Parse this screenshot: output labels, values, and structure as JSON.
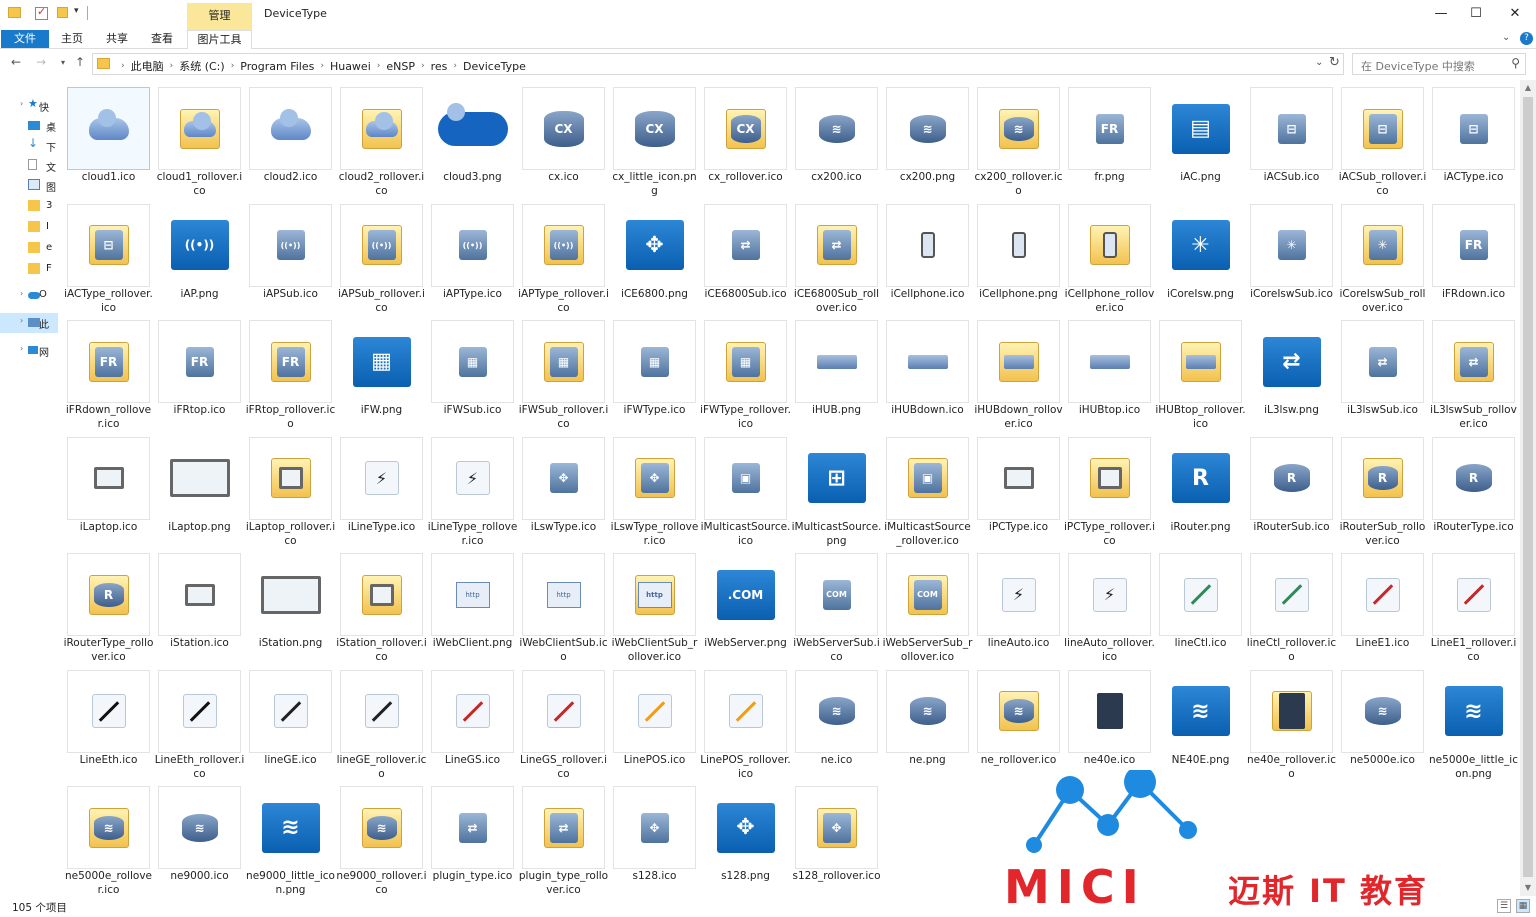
{
  "window": {
    "title": "DeviceType",
    "manage_tab": "管理",
    "minimize": "—",
    "maximize": "☐",
    "close": "✕"
  },
  "ribbon": {
    "tabs": [
      {
        "label": "文件"
      },
      {
        "label": "主页"
      },
      {
        "label": "共享"
      },
      {
        "label": "查看"
      },
      {
        "label": "图片工具"
      }
    ]
  },
  "address": {
    "crumbs": [
      "此电脑",
      "系统 (C:)",
      "Program Files",
      "Huawei",
      "eNSP",
      "res",
      "DeviceType"
    ],
    "search_placeholder": "在 DeviceType 中搜索"
  },
  "sidebar": {
    "items": [
      {
        "label": "快",
        "icon": "star-icon"
      },
      {
        "label": "桌",
        "icon": "desktop-icon"
      },
      {
        "label": "下",
        "icon": "download-icon"
      },
      {
        "label": "文",
        "icon": "document-icon"
      },
      {
        "label": "图",
        "icon": "picture-icon"
      },
      {
        "label": "3",
        "icon": "folder-icon"
      },
      {
        "label": "I",
        "icon": "folder-icon"
      },
      {
        "label": "e",
        "icon": "folder-icon"
      },
      {
        "label": "F",
        "icon": "folder-icon"
      },
      {
        "label": "O",
        "icon": "onedrive-icon"
      },
      {
        "label": "此",
        "icon": "this-pc-icon"
      },
      {
        "label": "网",
        "icon": "network-icon"
      }
    ]
  },
  "files": [
    {
      "name": "cloud1.ico",
      "icon": "cloud-icon",
      "selected": true
    },
    {
      "name": "cloud1_rollover.ico",
      "icon": "cloud-gold-icon"
    },
    {
      "name": "cloud2.ico",
      "icon": "cloud-icon"
    },
    {
      "name": "cloud2_rollover.ico",
      "icon": "cloud-gold-icon"
    },
    {
      "name": "cloud3.png",
      "icon": "cloud-big-icon"
    },
    {
      "name": "cx.ico",
      "icon": "cx-router-icon"
    },
    {
      "name": "cx_little_icon.png",
      "icon": "cx-router-icon"
    },
    {
      "name": "cx_rollover.ico",
      "icon": "cx-router-gold-icon"
    },
    {
      "name": "cx200.ico",
      "icon": "router-icon"
    },
    {
      "name": "cx200.png",
      "icon": "router-icon"
    },
    {
      "name": "cx200_rollover.ico",
      "icon": "router-gold-icon"
    },
    {
      "name": "fr.png",
      "icon": "frsw-icon"
    },
    {
      "name": "iAC.png",
      "icon": "ac-blue-icon"
    },
    {
      "name": "iACSub.ico",
      "icon": "ac-icon"
    },
    {
      "name": "iACSub_rollover.ico",
      "icon": "ac-gold-icon"
    },
    {
      "name": "iACType.ico",
      "icon": "ac-icon"
    },
    {
      "name": "iACType_rollover.ico",
      "icon": "ac-gold-icon"
    },
    {
      "name": "iAP.png",
      "icon": "ap-blue-icon"
    },
    {
      "name": "iAPSub.ico",
      "icon": "ap-icon"
    },
    {
      "name": "iAPSub_rollover.ico",
      "icon": "ap-gold-icon"
    },
    {
      "name": "iAPType.ico",
      "icon": "ap-icon"
    },
    {
      "name": "iAPType_rollover.ico",
      "icon": "ap-gold-icon"
    },
    {
      "name": "iCE6800.png",
      "icon": "ce-cloud-blue-icon"
    },
    {
      "name": "iCE6800Sub.ico",
      "icon": "switch-icon"
    },
    {
      "name": "iCE6800Sub_rollover.ico",
      "icon": "switch-gold-icon"
    },
    {
      "name": "iCellphone.ico",
      "icon": "cellphone-icon"
    },
    {
      "name": "iCellphone.png",
      "icon": "cellphone-icon"
    },
    {
      "name": "iCellphone_rollover.ico",
      "icon": "cellphone-gold-icon"
    },
    {
      "name": "iCoreIsw.png",
      "icon": "core-switch-blue-icon"
    },
    {
      "name": "iCoreIswSub.ico",
      "icon": "core-switch-icon"
    },
    {
      "name": "iCoreIswSub_rollover.ico",
      "icon": "core-switch-gold-icon"
    },
    {
      "name": "iFRdown.ico",
      "icon": "frsw-icon"
    },
    {
      "name": "iFRdown_rollover.ico",
      "icon": "frsw-gold-icon"
    },
    {
      "name": "iFRtop.ico",
      "icon": "frsw-icon"
    },
    {
      "name": "iFRtop_rollover.ico",
      "icon": "frsw-gold-icon"
    },
    {
      "name": "iFW.png",
      "icon": "firewall-blue-icon"
    },
    {
      "name": "iFWSub.ico",
      "icon": "firewall-icon"
    },
    {
      "name": "iFWSub_rollover.ico",
      "icon": "firewall-gold-icon"
    },
    {
      "name": "iFWType.ico",
      "icon": "firewall-icon"
    },
    {
      "name": "iFWType_rollover.ico",
      "icon": "firewall-gold-icon"
    },
    {
      "name": "iHUB.png",
      "icon": "hub-icon"
    },
    {
      "name": "iHUBdown.ico",
      "icon": "hub-icon"
    },
    {
      "name": "iHUBdown_rollover.ico",
      "icon": "hub-gold-icon"
    },
    {
      "name": "iHUBtop.ico",
      "icon": "hub-icon"
    },
    {
      "name": "iHUBtop_rollover.ico",
      "icon": "hub-gold-icon"
    },
    {
      "name": "iL3lsw.png",
      "icon": "l3-switch-blue-icon"
    },
    {
      "name": "iL3lswSub.ico",
      "icon": "l3-switch-icon"
    },
    {
      "name": "iL3lswSub_rollover.ico",
      "icon": "l3-switch-gold-icon"
    },
    {
      "name": "iLaptop.ico",
      "icon": "pc-icon"
    },
    {
      "name": "iLaptop.png",
      "icon": "desktop-pc-icon"
    },
    {
      "name": "iLaptop_rollover.ico",
      "icon": "pc-gold-icon"
    },
    {
      "name": "iLineType.ico",
      "icon": "line-type-icon"
    },
    {
      "name": "iLineType_rollover.ico",
      "icon": "line-type-gold-icon"
    },
    {
      "name": "iLswType.ico",
      "icon": "lsw-icon"
    },
    {
      "name": "iLswType_rollover.ico",
      "icon": "lsw-gold-icon"
    },
    {
      "name": "iMulticastSource.ico",
      "icon": "server-icon"
    },
    {
      "name": "iMulticastSource.png",
      "icon": "multicast-blue-icon"
    },
    {
      "name": "iMulticastSource_rollover.ico",
      "icon": "server-gold-icon"
    },
    {
      "name": "iPCType.ico",
      "icon": "monitor-icon"
    },
    {
      "name": "iPCType_rollover.ico",
      "icon": "monitor-gold-icon"
    },
    {
      "name": "iRouter.png",
      "icon": "router-blue-icon"
    },
    {
      "name": "iRouterSub.ico",
      "icon": "router-r-icon"
    },
    {
      "name": "iRouterSub_rollover.ico",
      "icon": "router-r-gold-icon"
    },
    {
      "name": "iRouterType.ico",
      "icon": "router-r-icon"
    },
    {
      "name": "iRouterType_rollover.ico",
      "icon": "router-r-gold-icon"
    },
    {
      "name": "iStation.ico",
      "icon": "laptop-icon"
    },
    {
      "name": "iStation.png",
      "icon": "laptop-big-icon"
    },
    {
      "name": "iStation_rollover.ico",
      "icon": "laptop-gold-icon"
    },
    {
      "name": "iWebClient.png",
      "icon": "webclient-icon"
    },
    {
      "name": "iWebClientSub.ico",
      "icon": "webclient-icon"
    },
    {
      "name": "iWebClientSub_rollover.ico",
      "icon": "webclient-gold-icon"
    },
    {
      "name": "iWebServer.png",
      "icon": "webserver-blue-icon"
    },
    {
      "name": "iWebServerSub.ico",
      "icon": "webserver-icon"
    },
    {
      "name": "iWebServerSub_rollover.ico",
      "icon": "webserver-gold-icon"
    },
    {
      "name": "lineAuto.ico",
      "icon": "line-auto-icon"
    },
    {
      "name": "lineAuto_rollover.ico",
      "icon": "line-auto-gold-icon"
    },
    {
      "name": "lineCtl.ico",
      "icon": "line-ctl-icon"
    },
    {
      "name": "lineCtl_rollover.ico",
      "icon": "line-ctl-gold-icon"
    },
    {
      "name": "LineE1.ico",
      "icon": "line-e1-icon"
    },
    {
      "name": "LineE1_rollover.ico",
      "icon": "line-e1-gold-icon"
    },
    {
      "name": "LineEth.ico",
      "icon": "line-eth-icon"
    },
    {
      "name": "LineEth_rollover.ico",
      "icon": "line-eth-gold-icon"
    },
    {
      "name": "lineGE.ico",
      "icon": "line-ge-icon"
    },
    {
      "name": "lineGE_rollover.ico",
      "icon": "line-ge-gold-icon"
    },
    {
      "name": "LineGS.ico",
      "icon": "line-gs-icon"
    },
    {
      "name": "LineGS_rollover.ico",
      "icon": "line-gs-gold-icon"
    },
    {
      "name": "LinePOS.ico",
      "icon": "line-pos-icon"
    },
    {
      "name": "LinePOS_rollover.ico",
      "icon": "line-pos-gold-icon"
    },
    {
      "name": "ne.ico",
      "icon": "ne-icon"
    },
    {
      "name": "ne.png",
      "icon": "ne-icon"
    },
    {
      "name": "ne_rollover.ico",
      "icon": "ne-gold-icon"
    },
    {
      "name": "ne40e.ico",
      "icon": "chassis-icon"
    },
    {
      "name": "NE40E.png",
      "icon": "ne-blue-icon"
    },
    {
      "name": "ne40e_rollover.ico",
      "icon": "chassis-gold-icon"
    },
    {
      "name": "ne5000e.ico",
      "icon": "ne-icon"
    },
    {
      "name": "ne5000e_little_icon.png",
      "icon": "ne-blue-icon"
    },
    {
      "name": "ne5000e_rollover.ico",
      "icon": "ne-gold-icon"
    },
    {
      "name": "ne9000.ico",
      "icon": "ne-icon"
    },
    {
      "name": "ne9000_little_icon.png",
      "icon": "ne-blue-icon"
    },
    {
      "name": "ne9000_rollover.ico",
      "icon": "ne-gold-icon"
    },
    {
      "name": "plugin_type.ico",
      "icon": "plugin-icon"
    },
    {
      "name": "plugin_type_rollover.ico",
      "icon": "plugin-gold-icon"
    },
    {
      "name": "s128.ico",
      "icon": "s128-icon"
    },
    {
      "name": "s128.png",
      "icon": "s128-blue-icon"
    },
    {
      "name": "s128_rollover.ico",
      "icon": "s128-gold-icon"
    }
  ],
  "status": {
    "item_count": "105 个项目"
  },
  "watermark": {
    "brand": "MICI",
    "brand_cn": "迈斯 IT 教育"
  },
  "colors": {
    "accent": "#1979ca",
    "gold": "#f2c24f",
    "device_blue": "#0a5fb0",
    "watermark_red": "#e1262c",
    "watermark_blue": "#1f8be0"
  }
}
